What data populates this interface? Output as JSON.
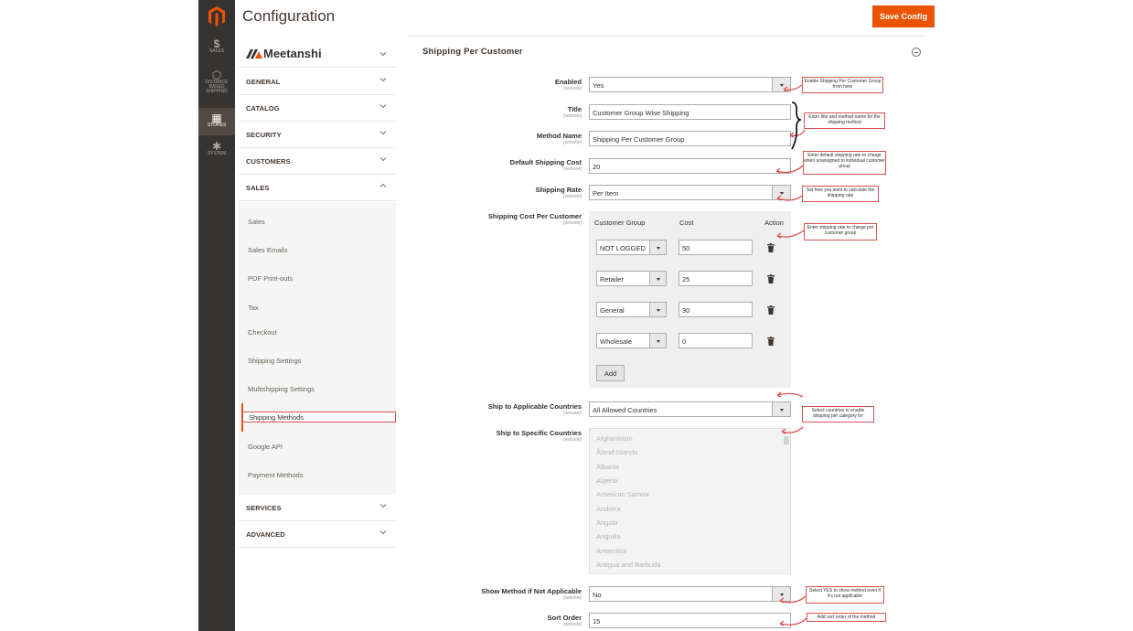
{
  "header": {
    "title": "Configuration",
    "save_label": "Save Config"
  },
  "admin_nav": [
    {
      "icon": "dollar-icon",
      "glyph": "$",
      "label": "SALES"
    },
    {
      "icon": "hexagon-icon",
      "glyph": "⬡",
      "label": "DISTANCE BASED SHIPPING"
    },
    {
      "icon": "store-icon",
      "glyph": "▦",
      "label": "STORES"
    },
    {
      "icon": "gear-icon",
      "glyph": "✱",
      "label": "SYSTEM"
    }
  ],
  "config_sidebar": {
    "brand": "Meetanshi",
    "tabs": [
      "GENERAL",
      "CATALOG",
      "SECURITY",
      "CUSTOMERS",
      "SALES"
    ],
    "sales_items": [
      "Sales",
      "Sales Emails",
      "PDF Print-outs",
      "Tax",
      "Checkout",
      "Shipping Settings",
      "Multishipping Settings",
      "Shipping Methods",
      "Google API",
      "Payment Methods"
    ],
    "bottom_tabs": [
      "SERVICES",
      "ADVANCED"
    ]
  },
  "section": {
    "title": "Shipping Per Customer",
    "scope": "[website]",
    "fields": {
      "enabled": {
        "label": "Enabled",
        "value": "Yes"
      },
      "title": {
        "label": "Title",
        "value": "Customer Group Wise Shipping"
      },
      "method_name": {
        "label": "Method Name",
        "value": "Shipping Per Customer Group"
      },
      "default_cost": {
        "label": "Default Shipping Cost",
        "value": "20"
      },
      "shipping_rate": {
        "label": "Shipping Rate",
        "value": "Per Item"
      },
      "cost_per_customer": {
        "label": "Shipping Cost Per Customer"
      },
      "ship_applicable": {
        "label": "Ship to Applicable Countries",
        "value": "All Allowed Countries"
      },
      "ship_specific": {
        "label": "Ship to Specific Countries"
      },
      "show_method": {
        "label": "Show Method if Not Applicable",
        "value": "No"
      },
      "sort_order": {
        "label": "Sort Order",
        "value": "15"
      }
    },
    "table": {
      "headers": [
        "Customer Group",
        "Cost",
        "Action"
      ],
      "rows": [
        {
          "group": "NOT LOGGED",
          "cost": "50"
        },
        {
          "group": "Retailer",
          "cost": "25"
        },
        {
          "group": "General",
          "cost": "30"
        },
        {
          "group": "Wholesale",
          "cost": "0"
        }
      ],
      "add_label": "Add"
    },
    "countries": [
      "Afghanistan",
      "Åland Islands",
      "Albania",
      "Algeria",
      "American Samoa",
      "Andorra",
      "Angola",
      "Anguilla",
      "Antarctica",
      "Antigua and Barbuda"
    ]
  },
  "annotations": {
    "enabled": "Enable Shipping Per Customer Group from here",
    "title": "Enter title and method name for the shipping method",
    "default_cost": "Enter default shipping rate to charge when unassigned to individual customer group",
    "shipping_rate": "Set how you want to calculate the shipping rate",
    "table": "Enter shipping rate to charge per customer group",
    "countries": "Select countries to enable shipping per category for",
    "show_method": "Select YES to show method even if it's not applicable",
    "sort_order": "Add sort order of the method"
  },
  "colors": {
    "accent": "#eb5202",
    "nav_bg": "#373330",
    "annotation_border": "#d9534f"
  }
}
